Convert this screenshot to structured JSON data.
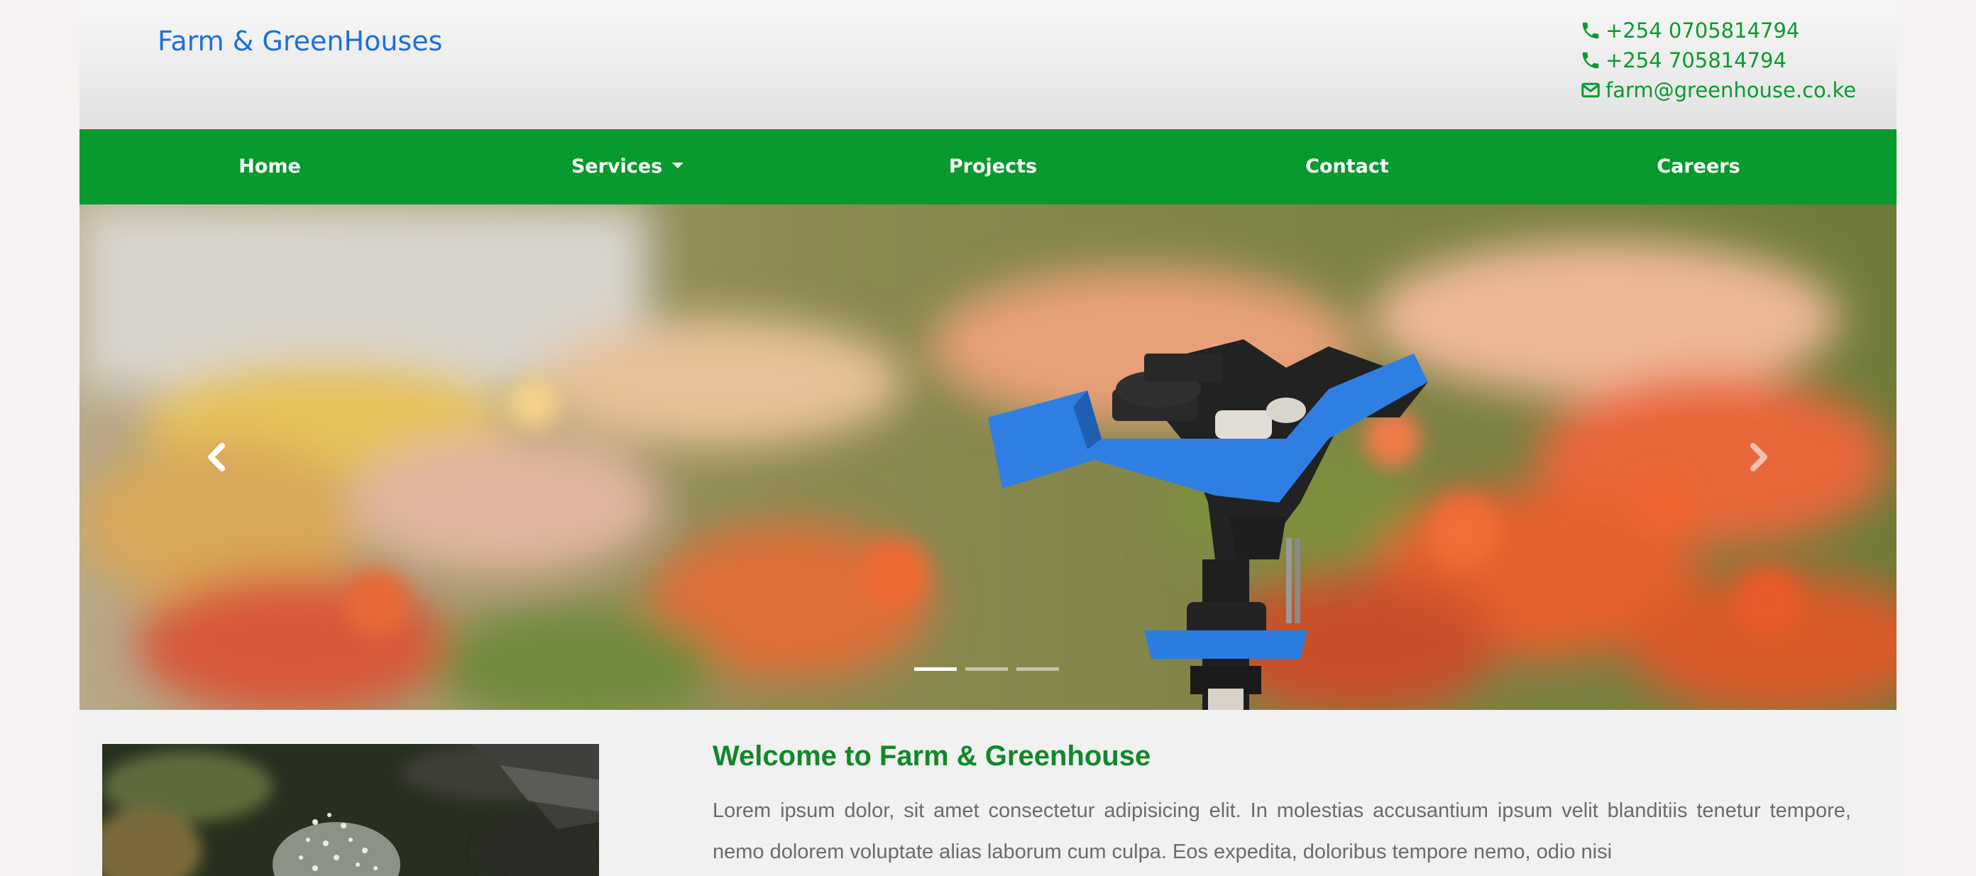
{
  "header": {
    "brand": "Farm & GreenHouses",
    "contacts": [
      {
        "icon": "phone-icon",
        "text": "+254 0705814794"
      },
      {
        "icon": "phone-icon",
        "text": "+254 705814794"
      },
      {
        "icon": "envelope-icon",
        "text": "farm@greenhouse.co.ke"
      }
    ]
  },
  "nav": {
    "items": [
      {
        "label": "Home"
      },
      {
        "label": "Services",
        "dropdown": true
      },
      {
        "label": "Projects"
      },
      {
        "label": "Contact"
      },
      {
        "label": "Careers"
      }
    ]
  },
  "carousel": {
    "slide_count": 3,
    "active_slide": 1,
    "prev_icon": "chevron-left-icon",
    "next_icon": "chevron-right-icon"
  },
  "welcome": {
    "title": "Welcome to Farm & Greenhouse",
    "text": "Lorem ipsum dolor, sit amet consectetur adipisicing elit. In molestias accusantium ipsum velit blanditiis tenetur tempore, nemo dolorem voluptate alias laborum cum culpa. Eos expedita, doloribus tempore nemo, odio nisi"
  },
  "colors": {
    "brand": "#1e6fd9",
    "nav_bg": "#089a2e",
    "accent_green": "#0a9a30"
  }
}
